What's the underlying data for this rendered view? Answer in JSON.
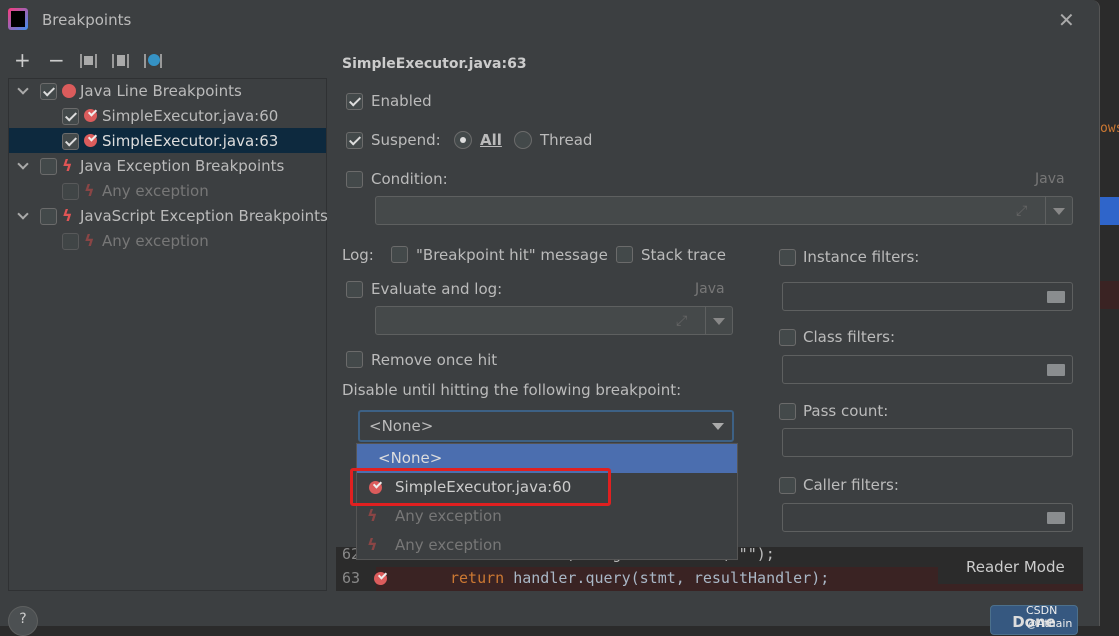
{
  "window": {
    "title": "Breakpoints"
  },
  "toolbar": {
    "add": "+",
    "remove": "−"
  },
  "tree": [
    {
      "label": "Java Line Breakpoints",
      "checked": true,
      "icon": "breakpoint-dot-icon"
    },
    {
      "label": "SimpleExecutor.java:60",
      "checked": true,
      "icon": "breakpoint-check-icon"
    },
    {
      "label": "SimpleExecutor.java:63",
      "checked": true,
      "icon": "breakpoint-check-icon",
      "selected": true
    },
    {
      "label": "Java Exception Breakpoints",
      "checked": false,
      "icon": "lightning-icon"
    },
    {
      "label": "Any exception",
      "checked": false,
      "icon": "lightning-icon"
    },
    {
      "label": "JavaScript Exception Breakpoints",
      "checked": false,
      "icon": "lightning-icon"
    },
    {
      "label": "Any exception",
      "checked": false,
      "icon": "lightning-icon"
    }
  ],
  "details": {
    "title": "SimpleExecutor.java:63",
    "enabled": "Enabled",
    "suspend": "Suspend:",
    "all": "All",
    "thread": "Thread",
    "condition": "Condition:",
    "lang": "Java",
    "log": "Log:",
    "breakpoint_hit": "\"Breakpoint hit\" message",
    "stack_trace": "Stack trace",
    "evaluate": "Evaluate and log:",
    "remove_once": "Remove once hit",
    "disable_until": "Disable until hitting the following breakpoint:",
    "select_value": "<None>",
    "instance_filters": "Instance filters:",
    "class_filters": "Class filters:",
    "pass_count": "Pass count:",
    "caller_filters": "Caller filters:"
  },
  "dropdown_options": [
    "<None>",
    "SimpleExecutor.java:60",
    "Any exception",
    "Any exception"
  ],
  "code": {
    "line62_num": "62",
    "line62": "ler, ms.getStatement(\"\"\");",
    "line63_num": "63",
    "line63_kw": "return",
    "line63": " handler.query(stmt, resultHandler);",
    "reader_mode": "Reader Mode",
    "bg_snippet": "ows"
  },
  "buttons": {
    "help": "?",
    "done": "Done"
  },
  "watermark": "CSDN @Athain",
  "colors": {
    "accent": "#4b6eaf",
    "highlight_box": "#e02020",
    "selection": "#0d293e",
    "breakpoint": "#db5c5c"
  }
}
